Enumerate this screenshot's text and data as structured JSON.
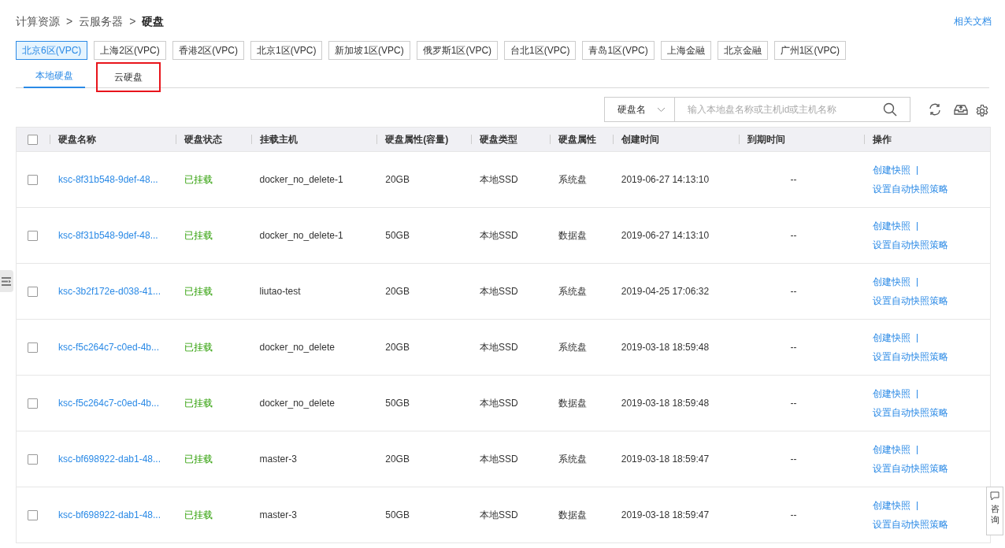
{
  "breadcrumb": [
    "计算资源",
    "云服务器",
    "硬盘"
  ],
  "breadcrumb_separator": ">",
  "doc_link": "相关文档",
  "regions": [
    {
      "label": "北京6区(VPC)",
      "selected": true
    },
    {
      "label": "上海2区(VPC)",
      "selected": false
    },
    {
      "label": "香港2区(VPC)",
      "selected": false
    },
    {
      "label": "北京1区(VPC)",
      "selected": false
    },
    {
      "label": "新加坡1区(VPC)",
      "selected": false
    },
    {
      "label": "俄罗斯1区(VPC)",
      "selected": false
    },
    {
      "label": "台北1区(VPC)",
      "selected": false
    },
    {
      "label": "青岛1区(VPC)",
      "selected": false
    },
    {
      "label": "上海金融",
      "selected": false
    },
    {
      "label": "北京金融",
      "selected": false
    },
    {
      "label": "广州1区(VPC)",
      "selected": false
    }
  ],
  "tabs": [
    {
      "label": "本地硬盘",
      "selected": true,
      "highlighted": false
    },
    {
      "label": "云硬盘",
      "selected": false,
      "highlighted": true
    }
  ],
  "filter": {
    "field": "硬盘名",
    "placeholder": "输入本地盘名称或主机id或主机名称"
  },
  "table": {
    "select_all_checked": false,
    "columns": [
      "硬盘名称",
      "硬盘状态",
      "挂载主机",
      "硬盘属性(容量)",
      "硬盘类型",
      "硬盘属性",
      "创建时间",
      "到期时间",
      "操作"
    ],
    "rows": [
      {
        "checked": false,
        "name": "ksc-8f31b548-9def-48...",
        "status": "已挂载",
        "host": "docker_no_delete-1",
        "capacity": "20GB",
        "type": "本地SSD",
        "attr": "系统盘",
        "created": "2019-06-27 14:13:10",
        "expires": "--",
        "actions": [
          "创建快照",
          "设置自动快照策略"
        ]
      },
      {
        "checked": false,
        "name": "ksc-8f31b548-9def-48...",
        "status": "已挂载",
        "host": "docker_no_delete-1",
        "capacity": "50GB",
        "type": "本地SSD",
        "attr": "数据盘",
        "created": "2019-06-27 14:13:10",
        "expires": "--",
        "actions": [
          "创建快照",
          "设置自动快照策略"
        ]
      },
      {
        "checked": false,
        "name": "ksc-3b2f172e-d038-41...",
        "status": "已挂载",
        "host": "liutao-test",
        "capacity": "20GB",
        "type": "本地SSD",
        "attr": "系统盘",
        "created": "2019-04-25 17:06:32",
        "expires": "--",
        "actions": [
          "创建快照",
          "设置自动快照策略"
        ]
      },
      {
        "checked": false,
        "name": "ksc-f5c264c7-c0ed-4b...",
        "status": "已挂载",
        "host": "docker_no_delete",
        "capacity": "20GB",
        "type": "本地SSD",
        "attr": "系统盘",
        "created": "2019-03-18 18:59:48",
        "expires": "--",
        "actions": [
          "创建快照",
          "设置自动快照策略"
        ]
      },
      {
        "checked": false,
        "name": "ksc-f5c264c7-c0ed-4b...",
        "status": "已挂载",
        "host": "docker_no_delete",
        "capacity": "50GB",
        "type": "本地SSD",
        "attr": "数据盘",
        "created": "2019-03-18 18:59:48",
        "expires": "--",
        "actions": [
          "创建快照",
          "设置自动快照策略"
        ]
      },
      {
        "checked": false,
        "name": "ksc-bf698922-dab1-48...",
        "status": "已挂载",
        "host": "master-3",
        "capacity": "20GB",
        "type": "本地SSD",
        "attr": "系统盘",
        "created": "2019-03-18 18:59:47",
        "expires": "--",
        "actions": [
          "创建快照",
          "设置自动快照策略"
        ]
      },
      {
        "checked": false,
        "name": "ksc-bf698922-dab1-48...",
        "status": "已挂载",
        "host": "master-3",
        "capacity": "50GB",
        "type": "本地SSD",
        "attr": "数据盘",
        "created": "2019-03-18 18:59:47",
        "expires": "--",
        "actions": [
          "创建快照",
          "设置自动快照策略"
        ]
      }
    ]
  },
  "consult": "咨询"
}
